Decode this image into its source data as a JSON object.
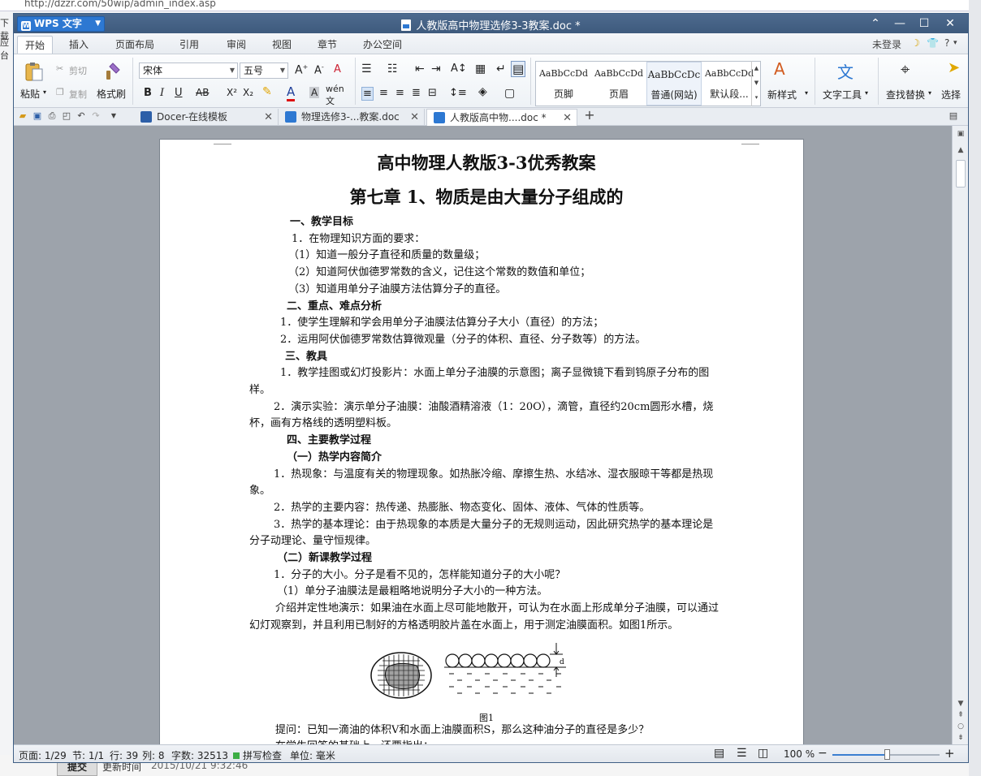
{
  "background": {
    "url": "http://dzzr.com/50wip/admin_index.asp",
    "left_fragments": [
      "下载",
      "应台"
    ],
    "submit_label": "提交",
    "update_label": "更新时间",
    "update_date": "2015/10/21 9:32:46"
  },
  "app": {
    "name": "WPS 文字",
    "window_title": "人教版高中物理选修3-3教案.doc *",
    "controls": {
      "collapse": "⌃",
      "minimize": "—",
      "maximize": "☐",
      "close": "✕"
    }
  },
  "menu": {
    "tabs": [
      "开始",
      "插入",
      "页面布局",
      "引用",
      "审阅",
      "视图",
      "章节",
      "办公空间"
    ],
    "active_tab": "开始",
    "right": {
      "login": "未登录",
      "help": "?"
    }
  },
  "ribbon": {
    "paste": "粘贴",
    "cut": "剪切",
    "copy": "复制",
    "format_painter": "格式刷",
    "font_name": "宋体",
    "font_size": "五号",
    "styles": [
      {
        "sample": "AaBbCcDd",
        "label": "页脚"
      },
      {
        "sample": "AaBbCcDd",
        "label": "页眉"
      },
      {
        "sample": "AaBbCcDc",
        "label": "普通(网站)"
      },
      {
        "sample": "AaBbCcDd",
        "label": "默认段..."
      }
    ],
    "new_style": "新样式",
    "text_tools": "文字工具",
    "find_replace": "查找替换",
    "select": "选择"
  },
  "doc_tabs": [
    {
      "label": "Docer-在线模板",
      "color": "#2d5fa8"
    },
    {
      "label": "物理选修3-...教案.doc",
      "color": "#2d78d2"
    },
    {
      "label": "人教版高中物....doc *",
      "color": "#2d78d2"
    }
  ],
  "document": {
    "title": "高中物理人教版3-3优秀教案",
    "chapter": "第七章  1、物质是由大量分子组成的",
    "paragraphs": [
      {
        "text": "一、教学目标",
        "bold": true,
        "indent": 50
      },
      {
        "text": "1．在物理知识方面的要求：",
        "indent": 52
      },
      {
        "text": "（1）知道一般分子直径和质量的数量级；",
        "indent": 48
      },
      {
        "text": "（2）知道阿伏伽德罗常数的含义，记住这个常数的数值和单位；",
        "indent": 48
      },
      {
        "text": "（3）知道用单分子油膜方法估算分子的直径。",
        "indent": 48
      },
      {
        "text": "二、重点、难点分析",
        "bold": true,
        "indent": 46
      },
      {
        "text": "1．使学生理解和学会用单分子油膜法估算分子大小（直径）的方法；",
        "indent": 38
      },
      {
        "text": "2．运用阿伏伽德罗常数估算微观量（分子的体积、直径、分子数等）的方法。",
        "indent": 38
      },
      {
        "text": "三、教具",
        "bold": true,
        "indent": 44
      },
      {
        "text": "1．教学挂图或幻灯投影片：水面上单分子油膜的示意图；离子显微镜下看到钨原子分布的图样。",
        "indent": 38,
        "wrap": true
      },
      {
        "text": "2．演示实验：演示单分子油膜：油酸酒精溶液（1：20O），滴管，直径约20cm圆形水槽，烧杯，画有方格线的透明塑料板。",
        "indent": 30,
        "wrap": true
      },
      {
        "text": "四、主要教学过程",
        "bold": true,
        "indent": 46
      },
      {
        "text": "（一）热学内容简介",
        "bold": true,
        "indent": 46
      },
      {
        "text": "1．热现象：与温度有关的物理现象。如热胀冷缩、摩擦生热、水结冰、湿衣服晾干等都是热现象。",
        "indent": 30,
        "wrap": true
      },
      {
        "text": "2．热学的主要内容：热传递、热膨胀、物态变化、固体、液体、气体的性质等。",
        "indent": 30
      },
      {
        "text": "3．热学的基本理论：由于热现象的本质是大量分子的无规则运动，因此研究热学的基本理论是分子动理论、量守恒规律。",
        "indent": 30,
        "wrap": true
      },
      {
        "text": "（二）新课教学过程",
        "bold": true,
        "indent": 34
      },
      {
        "text": "1．分子的大小。分子是看不见的，怎样能知道分子的大小呢？",
        "indent": 30
      },
      {
        "text": "（1）单分子油膜法是最粗略地说明分子大小的一种方法。",
        "indent": 34
      },
      {
        "text": "介绍并定性地演示：如果油在水面上尽可能地散开，可认为在水面上形成单分子油膜，可以通过幻灯观察到，并且利用已制好的方格透明胶片盖在水面上，用于测定油膜面积。如图1所示。",
        "indent": 32,
        "wrap": true
      }
    ],
    "figure": {
      "caption": "图1",
      "label_d": "d"
    },
    "after_figure": [
      {
        "text": "提问：已知一滴油的体积V和水面上油膜面积S，那么这种油分子的直径是多少？",
        "indent": 32
      },
      {
        "text": "在学生回答的基础上，还要指出：",
        "indent": 32
      }
    ]
  },
  "status": {
    "page": "页面: 1/29",
    "section": "节: 1/1",
    "row": "行: 39",
    "col": "列: 8",
    "word_count": "字数: 32513",
    "spell_check": "拼写检查",
    "unit": "单位: 毫米",
    "zoom": "100 %",
    "zoom_level": 0.5
  }
}
